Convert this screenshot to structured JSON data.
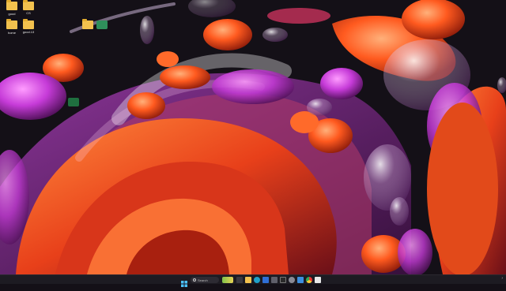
{
  "desktop": {
    "icons": [
      {
        "label": "",
        "type": "folder"
      },
      {
        "label": "good",
        "type": "folder"
      },
      {
        "label": "CS",
        "type": "folder"
      },
      {
        "label": "",
        "type": "folder"
      },
      {
        "label": "home",
        "type": "folder"
      },
      {
        "label": "good.13",
        "type": "folder"
      },
      {
        "label": "",
        "type": "folder"
      },
      {
        "label": "",
        "type": "app"
      },
      {
        "label": "",
        "type": "app"
      }
    ]
  },
  "taskbar": {
    "search_placeholder": "Search",
    "pinned_icons": [
      "windows-start-icon",
      "weather-widget-icon",
      "task-view-icon",
      "file-explorer-icon",
      "edge-browser-icon",
      "mail-icon",
      "store-icon",
      "terminal-icon",
      "settings-icon",
      "photos-icon",
      "chrome-icon",
      "notes-icon"
    ]
  },
  "colors": {
    "background": "#141017",
    "orange": "#ff5a1f",
    "magenta": "#c63bd8",
    "taskbar": "#1d1b22"
  }
}
